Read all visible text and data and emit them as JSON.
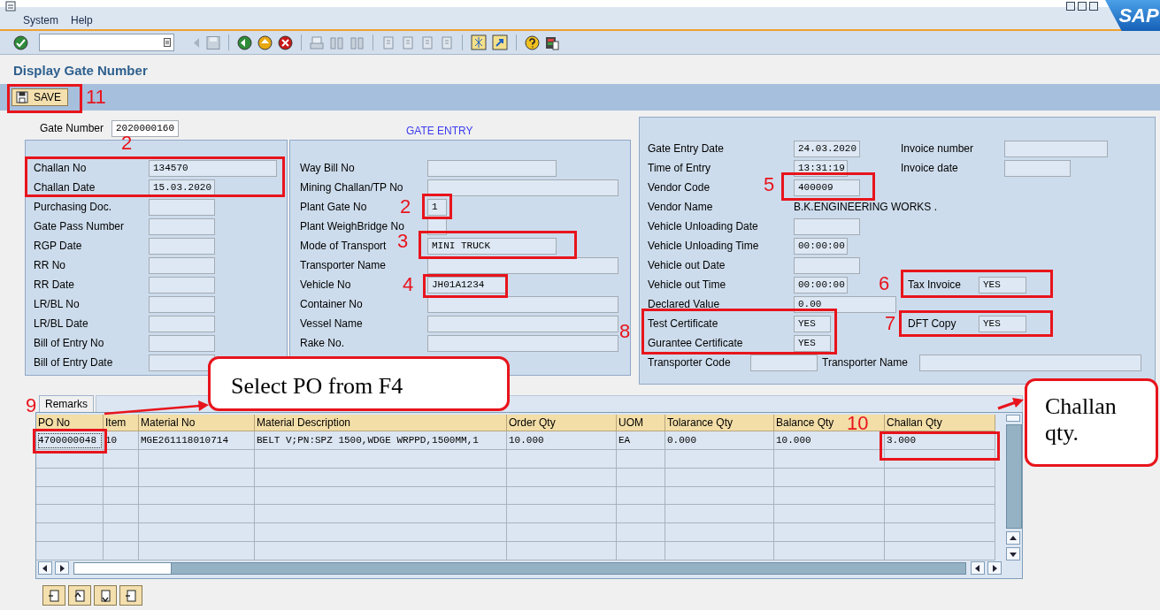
{
  "menu": [
    {
      "label": "System"
    },
    {
      "label": "Help"
    }
  ],
  "logo": "SAP",
  "title": "Display Gate Number",
  "save_button": "SAVE",
  "gate_number": {
    "label": "Gate Number",
    "value": "2020000160"
  },
  "section_heading": "GATE ENTRY",
  "left_panel": {
    "fields": [
      {
        "label": "Challan No",
        "value": "134570"
      },
      {
        "label": "Challan Date",
        "value": "15.03.2020"
      },
      {
        "label": "Purchasing Doc."
      },
      {
        "label": "Gate Pass Number"
      },
      {
        "label": "RGP Date"
      },
      {
        "label": "RR No"
      },
      {
        "label": "RR Date"
      },
      {
        "label": "LR/BL No"
      },
      {
        "label": "LR/BL Date"
      },
      {
        "label": "Bill of Entry No"
      },
      {
        "label": "Bill of Entry Date"
      }
    ]
  },
  "middle_panel": {
    "fields": [
      {
        "label": "Way Bill No"
      },
      {
        "label": "Mining Challan/TP No"
      },
      {
        "label": "Plant Gate No",
        "value": "1"
      },
      {
        "label": "Plant WeighBridge No"
      },
      {
        "label": "Mode of Transport",
        "value": "MINI TRUCK"
      },
      {
        "label": "Transporter Name"
      },
      {
        "label": "Vehicle No",
        "value": "JH01A1234"
      },
      {
        "label": "Container No"
      },
      {
        "label": "Vessel Name"
      },
      {
        "label": "Rake No."
      }
    ]
  },
  "right_panel": {
    "fields": [
      {
        "kind": "field",
        "label": "Gate Entry Date",
        "value": "24.03.2020",
        "side": {
          "label": "Invoice number"
        }
      },
      {
        "kind": "field",
        "label": "Time of Entry",
        "value": "13:31:19",
        "side": {
          "label": "Invoice date"
        }
      },
      {
        "kind": "field",
        "label": "Vendor Code",
        "value": "400009"
      },
      {
        "kind": "text",
        "label": "Vendor Name",
        "value": "B.K.ENGINEERING WORKS ."
      },
      {
        "kind": "field",
        "label": "Vehicle Unloading Date"
      },
      {
        "kind": "field",
        "label": "Vehicle Unloading Time",
        "value": "00:00:00"
      },
      {
        "kind": "field",
        "label": "Vehicle out Date"
      },
      {
        "kind": "field",
        "label": "Vehicle out Time",
        "value": "00:00:00",
        "side": {
          "label": "Tax Invoice",
          "value": "YES"
        }
      },
      {
        "kind": "field",
        "label": "Declared Value",
        "value": "0.00"
      },
      {
        "kind": "field",
        "label": "Test Certificate",
        "value": "YES",
        "side": {
          "label": "DFT Copy",
          "value": "YES"
        }
      },
      {
        "kind": "field",
        "label": "Gurantee Certificate",
        "value": "YES"
      }
    ],
    "bottom_row": [
      {
        "label": "Transporter Code"
      },
      {
        "label": "Transporter Name"
      }
    ]
  },
  "table": {
    "tab": "Remarks",
    "columns": [
      "PO No",
      "Item",
      "Material No",
      "Material Description",
      "Order Qty",
      "UOM",
      "Tolarance Qty",
      "Balance Qty",
      "Challan Qty"
    ],
    "rows": [
      [
        "4700000048",
        "10",
        "MGE261118010714",
        "BELT V;PN:SPZ 1500,WDGE WRPPD,1500MM,1",
        "10.000",
        "EA",
        "0.000",
        "10.000",
        "3.000"
      ]
    ]
  },
  "annotations": {
    "markers": [
      "11",
      "2",
      "2",
      "3",
      "4",
      "5",
      "6",
      "7",
      "8",
      "9",
      "10"
    ],
    "callouts": [
      "Select PO from F4",
      "Challan\nqty."
    ]
  }
}
